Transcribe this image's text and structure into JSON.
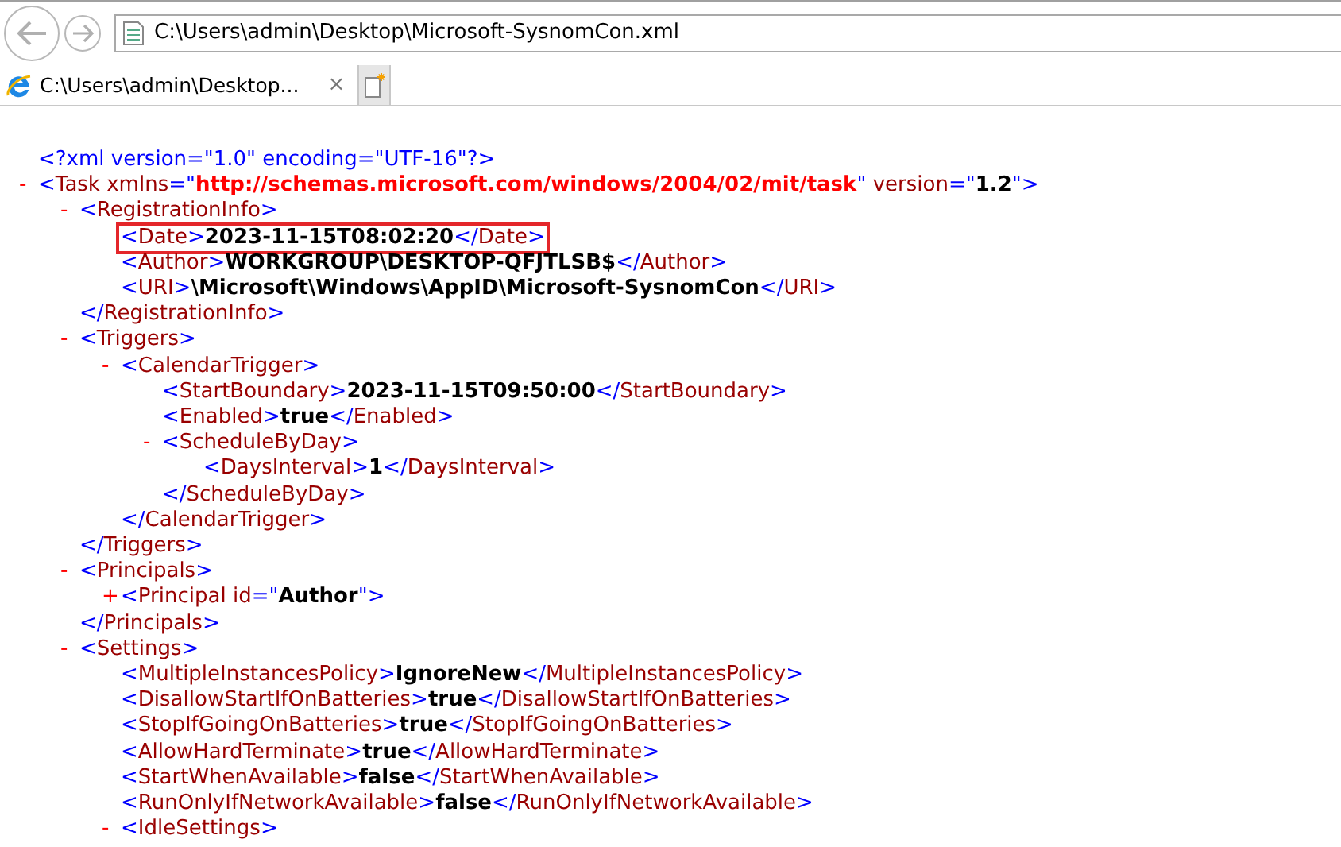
{
  "address_bar": {
    "value": "C:\\Users\\admin\\Desktop\\Microsoft-SysnomCon.xml"
  },
  "tabs": [
    {
      "label": "C:\\Users\\admin\\Desktop...",
      "close": "×",
      "selected": true
    }
  ],
  "document": [
    {
      "kind": "declaration",
      "open": "<?xml version=\"1.0\" encoding=\"UTF-16\"?>"
    },
    {
      "kind": "element",
      "toggle": "-",
      "open": "<Task xmlns=\"http://schemas.microsoft.com/windows/2004/02/mit/task\" version=\"1.2\">",
      "namespace_value": true,
      "children": [
        {
          "kind": "element",
          "toggle": "-",
          "open": "<RegistrationInfo>",
          "close": "</RegistrationInfo>",
          "children": [
            {
              "kind": "element",
              "open": "<Date>",
              "text": "2023-11-15T08:02:20",
              "close": "</Date>",
              "highlighted": true
            },
            {
              "kind": "element",
              "open": "<Author>",
              "text": "WORKGROUP\\DESKTOP-QFJTLSB$",
              "close": "</Author>",
              "highlighted": false
            },
            {
              "kind": "element",
              "open": "<URI>",
              "text": "\\Microsoft\\Windows\\AppID\\Microsoft-SysnomCon",
              "close": "</URI>",
              "highlighted": false
            }
          ]
        },
        {
          "kind": "element",
          "toggle": "-",
          "open": "<Triggers>",
          "close": "</Triggers>",
          "children": [
            {
              "kind": "element",
              "toggle": "-",
              "open": "<CalendarTrigger>",
              "close": "</CalendarTrigger>",
              "children": [
                {
                  "kind": "element",
                  "open": "<StartBoundary>",
                  "text": "2023-11-15T09:50:00",
                  "close": "</StartBoundary>",
                  "highlighted": false
                },
                {
                  "kind": "element",
                  "open": "<Enabled>",
                  "text": "true",
                  "close": "</Enabled>",
                  "highlighted": false
                },
                {
                  "kind": "element",
                  "toggle": "-",
                  "open": "<ScheduleByDay>",
                  "close": "</ScheduleByDay>",
                  "children": [
                    {
                      "kind": "element",
                      "open": "<DaysInterval>",
                      "text": "1",
                      "close": "</DaysInterval>",
                      "highlighted": false
                    }
                  ]
                }
              ]
            }
          ]
        },
        {
          "kind": "element",
          "toggle": "-",
          "open": "<Principals>",
          "close": "</Principals>",
          "children": [
            {
              "kind": "collapsed",
              "toggle": "+",
              "open": "<Principal id=\"Author\">",
              "namespace_value": false
            }
          ]
        },
        {
          "kind": "element",
          "toggle": "-",
          "open": "<Settings>",
          "children": [
            {
              "kind": "element",
              "open": "<MultipleInstancesPolicy>",
              "text": "IgnoreNew",
              "close": "</MultipleInstancesPolicy>",
              "highlighted": false
            },
            {
              "kind": "element",
              "open": "<DisallowStartIfOnBatteries>",
              "text": "true",
              "close": "</DisallowStartIfOnBatteries>",
              "highlighted": false
            },
            {
              "kind": "element",
              "open": "<StopIfGoingOnBatteries>",
              "text": "true",
              "close": "</StopIfGoingOnBatteries>",
              "highlighted": false
            },
            {
              "kind": "element",
              "open": "<AllowHardTerminate>",
              "text": "true",
              "close": "</AllowHardTerminate>",
              "highlighted": false
            },
            {
              "kind": "element",
              "open": "<StartWhenAvailable>",
              "text": "false",
              "close": "</StartWhenAvailable>",
              "highlighted": false
            },
            {
              "kind": "element",
              "open": "<RunOnlyIfNetworkAvailable>",
              "text": "false",
              "close": "</RunOnlyIfNetworkAvailable>",
              "highlighted": false
            },
            {
              "kind": "element",
              "toggle": "-",
              "open": "<IdleSettings>"
            }
          ]
        }
      ]
    }
  ]
}
